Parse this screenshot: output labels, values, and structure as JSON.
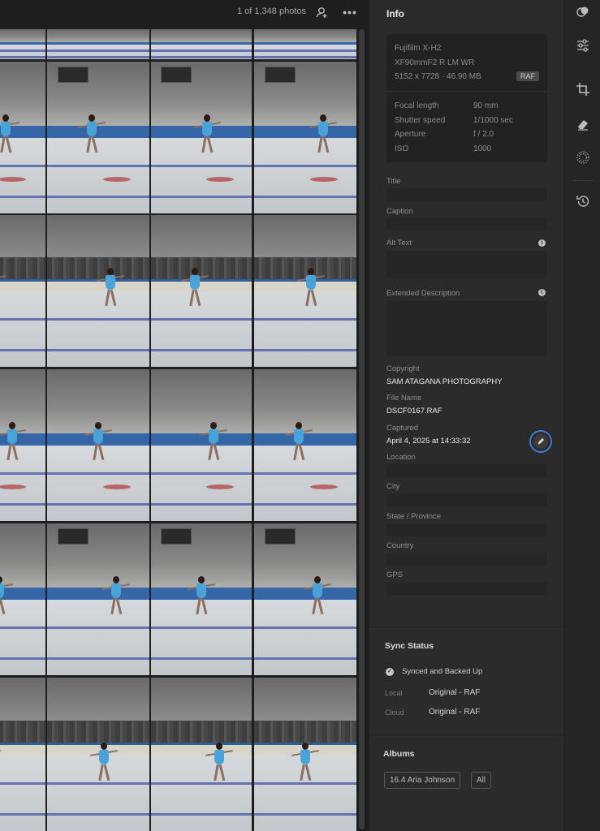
{
  "topbar": {
    "photo_count": "1 of 1,348 photos",
    "icons": [
      "add-people-icon",
      "more-options-icon"
    ]
  },
  "grid": {
    "selected_index": 14,
    "columns": 4
  },
  "panel": {
    "title": "Info",
    "exif": {
      "camera": "Fujifilm X-H2",
      "lens": "XF90mmF2 R LM WR",
      "dimensions_size": "5152 x 7728  ·  46.90 MB",
      "format_badge": "RAF",
      "rows": [
        {
          "key": "Focal length",
          "value": "90 mm"
        },
        {
          "key": "Shutter speed",
          "value": "1/1000 sec"
        },
        {
          "key": "Aperture",
          "value": "f / 2.0"
        },
        {
          "key": "ISO",
          "value": "1000"
        }
      ]
    },
    "fields": {
      "title_label": "Title",
      "caption_label": "Caption",
      "alt_text_label": "Alt Text",
      "extended_description_label": "Extended Description",
      "copyright_label": "Copyright",
      "copyright_value": "SAM ATAGANA PHOTOGRAPHY",
      "file_name_label": "File Name",
      "file_name_value": "DSCF0167.RAF",
      "captured_label": "Captured",
      "captured_value": "April 4, 2025 at 14:33:32",
      "location_label": "Location",
      "city_label": "City",
      "state_label": "State / Province",
      "country_label": "Country",
      "gps_label": "GPS"
    },
    "sync": {
      "title": "Sync Status",
      "status": "Synced and Backed Up",
      "local_label": "Local",
      "local_value": "Original - RAF",
      "cloud_label": "Cloud",
      "cloud_value": "Original - RAF"
    },
    "albums": {
      "title": "Albums",
      "items": [
        "16.4 Aria Johnson",
        "All"
      ]
    }
  },
  "toolbar": {
    "tools": [
      "presets-icon",
      "edit-sliders-icon",
      "crop-icon",
      "eraser-icon",
      "masking-icon",
      "history-icon"
    ]
  }
}
